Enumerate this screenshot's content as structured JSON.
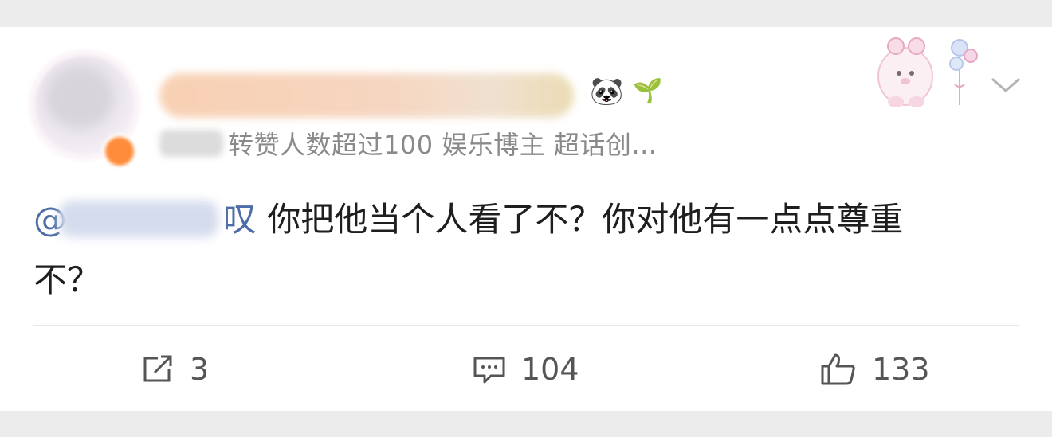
{
  "post": {
    "author": {
      "name": "",
      "badges": [
        "panda-emoji",
        "sprout-emoji"
      ],
      "meta": "转赞人数超过100  娱乐博主 超话创..."
    },
    "content": {
      "mention_prefix": "@",
      "mention_suffix": "叹",
      "text_line1": "你把他当个人看了不？你对他有一点点尊重",
      "text_line2": "不？"
    },
    "actions": {
      "repost_count": "3",
      "comment_count": "104",
      "like_count": "133"
    }
  },
  "icons": {
    "repost": "repost-icon",
    "comment": "comment-icon",
    "like": "thumbs-up-icon",
    "menu": "chevron-down-icon"
  },
  "colors": {
    "mention": "#4c6da5",
    "text": "#1e1e1e",
    "meta": "#8a8a8a",
    "icon": "#555555"
  }
}
